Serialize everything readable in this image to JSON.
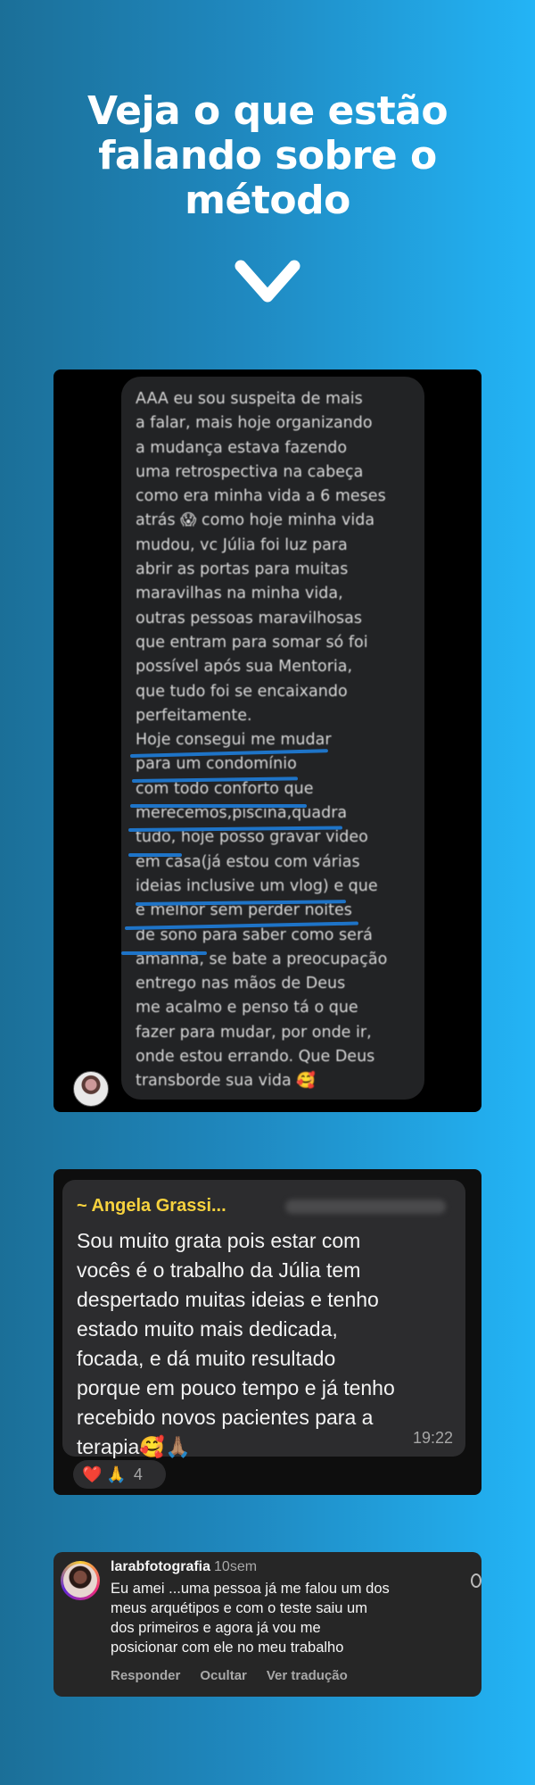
{
  "headline": {
    "lines": [
      "Veja o que estão",
      "falando sobre o",
      "método"
    ]
  },
  "testimonial_1": {
    "lines": [
      "AAA eu sou suspeita de mais",
      "a falar, mais hoje organizando",
      "a mudança estava fazendo",
      "uma retrospectiva na cabeça",
      "como era minha vida a 6 meses",
      "atrás 😱 como hoje minha vida",
      "mudou, vc Júlia foi luz para",
      "abrir as portas para muitas",
      "maravilhas na minha vida,",
      "outras pessoas maravilhosas",
      "que entram para somar só foi",
      "possível após sua Mentoria,",
      "que tudo foi se encaixando",
      "perfeitamente.",
      "Hoje consegui me mudar",
      "para um condomínio",
      "com todo conforto que",
      "merecemos,piscina,quadra",
      "tudo, hoje posso gravar video",
      "em casa(já estou com várias",
      "ideias inclusive um vlog) e que",
      "e melhor sem perder noites",
      "de sono para saber como será",
      "amanhã, se bate a preocupação",
      "entrego nas mãos de Deus",
      "me acalmo e penso tá o que",
      "fazer para mudar, por onde ir,",
      "onde estou errando. Que Deus",
      "transborde sua vida 🥰"
    ]
  },
  "testimonial_2": {
    "sender": "~ Angela Grassi...",
    "lines": [
      "Sou muito grata pois estar com",
      "vocês é o trabalho da Júlia tem",
      "despertado muitas ideias e tenho",
      "estado muito mais dedicada,",
      "focada, e dá muito resultado",
      "porque em pouco tempo e já tenho",
      "recebido novos pacientes para a",
      "terapia🥰🙏🏽"
    ],
    "time": "19:22",
    "reaction_icons": "❤️ 🙏",
    "reaction_count": "4"
  },
  "testimonial_3": {
    "username": "larabfotografia",
    "age": "10sem",
    "lines": [
      "Eu amei ...uma pessoa já me falou um dos",
      "meus arquétipos e com o teste saiu um",
      "dos primeiros e agora já vou me",
      "posicionar com ele no meu trabalho"
    ],
    "actions": {
      "reply": "Responder",
      "hide": "Ocultar",
      "translate": "Ver tradução"
    }
  },
  "colors": {
    "accent_underline": "#1e74c8",
    "sender_name": "#f7d23e",
    "background_start": "#1b6f98",
    "background_end": "#23b4f6"
  }
}
